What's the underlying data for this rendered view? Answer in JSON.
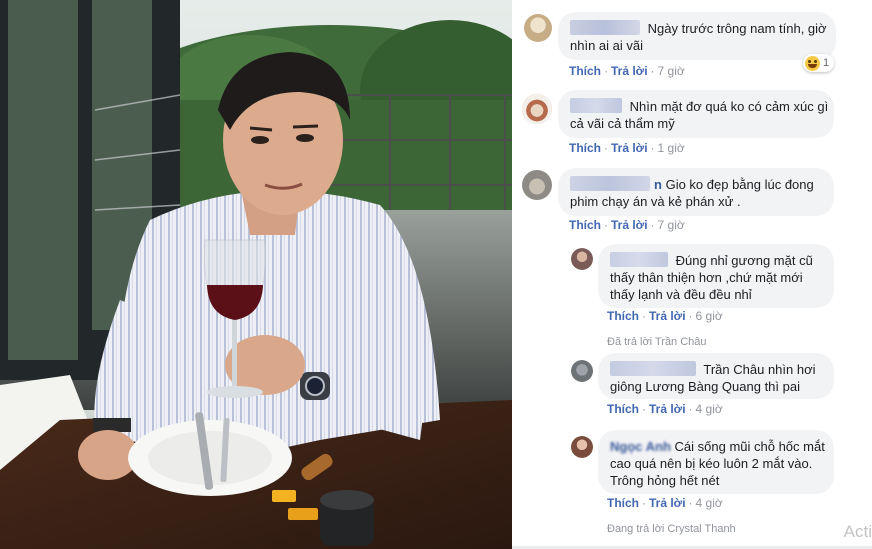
{
  "comments": [
    {
      "text_lines": [
        "Ngày trước trông nam tính, giờ",
        "nhìn ai ai vãi"
      ],
      "like": "Thích",
      "reply": "Trả lời",
      "time": "7 giờ",
      "reaction_count": "1",
      "reaction_icon": "haha-emoji-icon"
    },
    {
      "text_lines": [
        "Nhìn mặt đơ quá ko có cảm xúc gì",
        "cả vãi cả thẩm mỹ"
      ],
      "like": "Thích",
      "reply": "Trả lời",
      "time": "1 giờ"
    },
    {
      "name_visible": "n",
      "text_lines": [
        "Gio ko đẹp bằng lúc đong",
        "phim chạy án và kẻ phán xử ."
      ],
      "like": "Thích",
      "reply": "Trả lời",
      "time": "7 giờ"
    }
  ],
  "replies": [
    {
      "text_lines": [
        "Đúng nhỉ gương mặt cũ",
        "thấy thân thiện hơn ,chứ mặt mới",
        "thấy lạnh và đều đều nhỉ"
      ],
      "like": "Thích",
      "reply": "Trả lời",
      "time": "6 giờ",
      "replied_by": "Đã trả lời Trần Châu"
    },
    {
      "text_lines": [
        "Trần Châu nhìn hơi",
        "giông Lương Bàng Quang thì pai"
      ],
      "like": "Thích",
      "reply": "Trả lời",
      "time": "4 giờ"
    },
    {
      "name_visible": "Ngọc Anh",
      "text_lines": [
        "Cái sống mũi chỗ hốc mắt",
        "cao quá nên bị kéo luôn 2 mắt vào.",
        "Trông hỏng hết nét"
      ],
      "like": "Thích",
      "reply": "Trả lời",
      "time": "4 giờ",
      "replied_by": "Đang trả lời Crystal Thanh"
    }
  ],
  "watermark": "Acti",
  "colors": {
    "link": "#4267b2",
    "bubble": "#f2f3f5",
    "meta": "#90949c",
    "text": "#1c1e21"
  }
}
